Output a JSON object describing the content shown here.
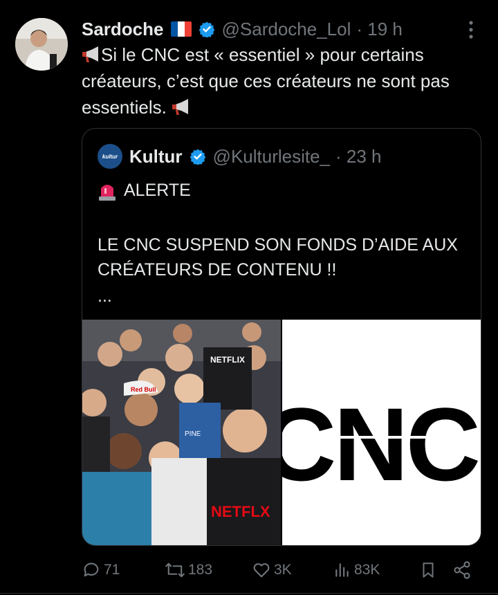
{
  "tweet": {
    "author_name": "Sardoche",
    "author_handle": "@Sardoche_Lol",
    "time": "· 19 h",
    "text": "Si le CNC est « essentiel » pour certains créateurs, c’est que ces créateurs ne sont pas essentiels."
  },
  "quote": {
    "author_name": "Kultur",
    "author_handle": "@Kulturlesite_",
    "time": "· 23 h",
    "avatar_text": "kultur",
    "alert": "ALERTE",
    "body": "LE CNC SUSPEND SON FONDS D’AIDE AUX CRÉATEURS DE CONTENU !!",
    "ellipsis": "...",
    "image_right_text": "CNC",
    "image_left_texts": [
      "NETFLIX",
      "NETFLX",
      "Red Bull",
      "PINE"
    ]
  },
  "actions": {
    "replies": "71",
    "reposts": "183",
    "likes": "3K",
    "views": "83K"
  },
  "colors": {
    "background": "#000000",
    "text": "#e7e9ea",
    "muted": "#71767b",
    "verified": "#1d9bf0",
    "border": "#2f3336"
  }
}
